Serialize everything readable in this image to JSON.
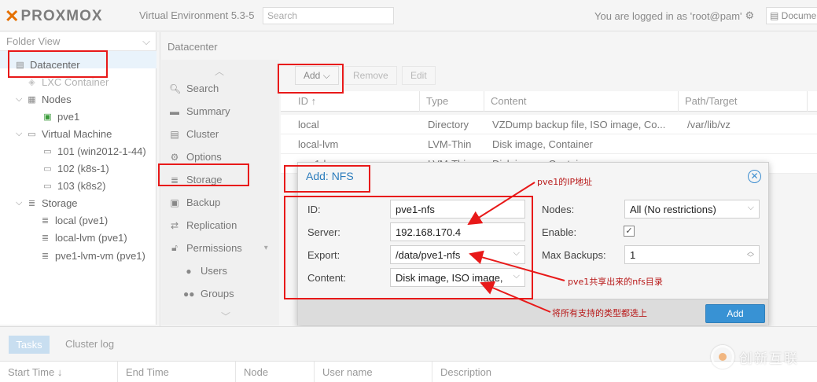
{
  "header": {
    "brand": "PROXMOX",
    "version": "Virtual Environment 5.3-5",
    "search_placeholder": "Search",
    "login_text": "You are logged in as 'root@pam'",
    "docs_label": "Documentation"
  },
  "tree": {
    "view_label": "Folder View",
    "datacenter": "Datacenter",
    "items": [
      {
        "label": "LXC Container"
      },
      {
        "label": "Nodes"
      },
      {
        "label": "pve1"
      },
      {
        "label": "Virtual Machine"
      },
      {
        "label": "101 (win2012-1-44)"
      },
      {
        "label": "102 (k8s-1)"
      },
      {
        "label": "103 (k8s2)"
      },
      {
        "label": "Storage"
      },
      {
        "label": "local (pve1)"
      },
      {
        "label": "local-lvm (pve1)"
      },
      {
        "label": "pve1-lvm-vm (pve1)"
      }
    ]
  },
  "content": {
    "title": "Datacenter",
    "menu": [
      "Search",
      "Summary",
      "Cluster",
      "Options",
      "Storage",
      "Backup",
      "Replication",
      "Permissions",
      "Users",
      "Groups"
    ],
    "toolbar": {
      "add": "Add",
      "remove": "Remove",
      "edit": "Edit"
    },
    "grid": {
      "columns": [
        "ID ↑",
        "Type",
        "Content",
        "Path/Target"
      ],
      "rows": [
        {
          "id": "local",
          "type": "Directory",
          "content": "VZDump backup file, ISO image, Co...",
          "path": "/var/lib/vz"
        },
        {
          "id": "local-lvm",
          "type": "LVM-Thin",
          "content": "Disk image, Container",
          "path": ""
        },
        {
          "id": "pve1-lvm",
          "type": "LVM-Thin",
          "content": "Disk image, Container",
          "path": ""
        }
      ]
    }
  },
  "dialog": {
    "title": "Add: NFS",
    "id_label": "ID:",
    "id_value": "pve1-nfs",
    "server_label": "Server:",
    "server_value": "192.168.170.4",
    "export_label": "Export:",
    "export_value": "/data/pve1-nfs",
    "content_label": "Content:",
    "content_value": "Disk image, ISO image,",
    "nodes_label": "Nodes:",
    "nodes_value": "All (No restrictions)",
    "enable_label": "Enable:",
    "enable_checked": true,
    "maxbackups_label": "Max Backups:",
    "maxbackups_value": "1",
    "add_button": "Add"
  },
  "annotations": {
    "ip": "pve1的IP地址",
    "export": "pve1共享出来的nfs目录",
    "content": "将所有支持的类型都选上"
  },
  "bottom": {
    "tabs": [
      "Tasks",
      "Cluster log"
    ],
    "columns": [
      "Start Time ↓",
      "End Time",
      "Node",
      "User name",
      "Description"
    ]
  },
  "watermark": "创新互联",
  "colors": {
    "accent": "#3892d4",
    "annotation": "#e81919",
    "brand_x": "#e57000"
  }
}
